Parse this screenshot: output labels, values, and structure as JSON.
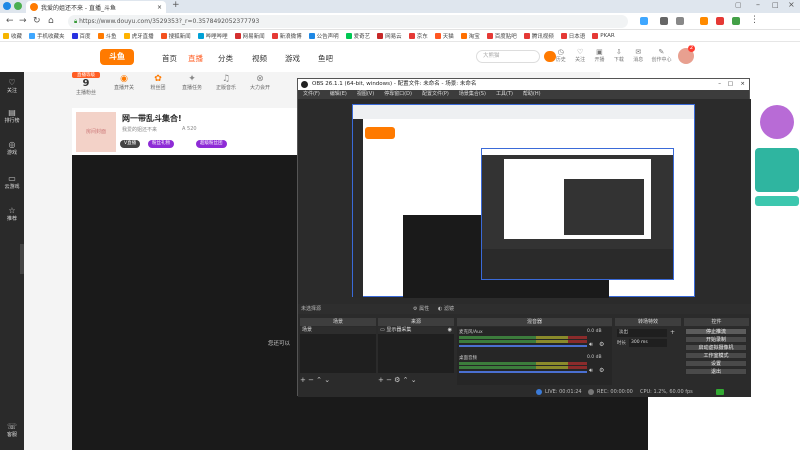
{
  "browser": {
    "tab_title": "我爱的姐还不来 - 直播_斗鱼",
    "url": "https://www.douyu.com/3529353?_r=0.3578492052377793"
  },
  "bookmarks": [
    "收藏",
    "手机收藏夹",
    "百度",
    "斗鱼",
    "虎牙直播",
    "搜狐新闻",
    "哔哩哔哩",
    "网易新闻",
    "新浪微博",
    "公告声明",
    "爱奇艺",
    "网易云",
    "京东",
    "天猫",
    "淘宝",
    "百度贴吧",
    "腾讯视频",
    "日本语",
    "PKAR"
  ],
  "douyu": {
    "nav": [
      "首页",
      "直播",
      "分类",
      "视频",
      "游戏",
      "鱼吧"
    ],
    "search_placeholder": "大熊猫",
    "top_right": [
      "历史",
      "关注",
      "开播",
      "下载",
      "消息",
      "创作中心"
    ],
    "badge": "2",
    "level_label": "主播粉丝",
    "level_value": "9",
    "tabs": [
      "直播开关",
      "粉丝团",
      "直播任务",
      "正版音乐",
      "大力会开"
    ],
    "room_title": "网一带乱斗集合!",
    "room_sub": "我爱的姐还不来",
    "room_category": "英雄联盟",
    "room_pills": [
      "V直播",
      "粉丝礼物",
      "超级粉丝团"
    ],
    "room_small": "A 520",
    "side": [
      "关注",
      "排行榜",
      "游戏",
      "云游戏",
      "推荐",
      "客服"
    ],
    "chat_line": "您还可以"
  },
  "obs": {
    "title": "OBS 26.1.1 (64-bit, windows) - 配置文件: 未命名 - 场景: 未命名",
    "menu": [
      "文件(F)",
      "编辑(E)",
      "视图(V)",
      "停靠窗口(D)",
      "配置文件(P)",
      "场景集合(S)",
      "工具(T)",
      "帮助(H)"
    ],
    "docks": [
      "场景",
      "来源",
      "混音器",
      "转场特效",
      "控件"
    ],
    "scene_item": "场景",
    "source_item": "显示器采集",
    "mixer": [
      {
        "name": "麦克风/Aux",
        "db": "0.0 dB"
      },
      {
        "name": "桌面音频",
        "db": "0.0 dB"
      }
    ],
    "transition": {
      "type": "淡出",
      "duration_label": "时长",
      "duration": "300 ms"
    },
    "controls": [
      "停止推流",
      "开始录制",
      "启动虚拟摄像机",
      "工作室模式",
      "设置",
      "退出"
    ],
    "status": {
      "live": "LIVE: 00:01:24",
      "rec": "REC: 00:00:00",
      "cpu": "CPU: 1.2%, 60.00 fps"
    },
    "no_source": "未选择源",
    "props": "属性",
    "filters": "滤镜"
  }
}
